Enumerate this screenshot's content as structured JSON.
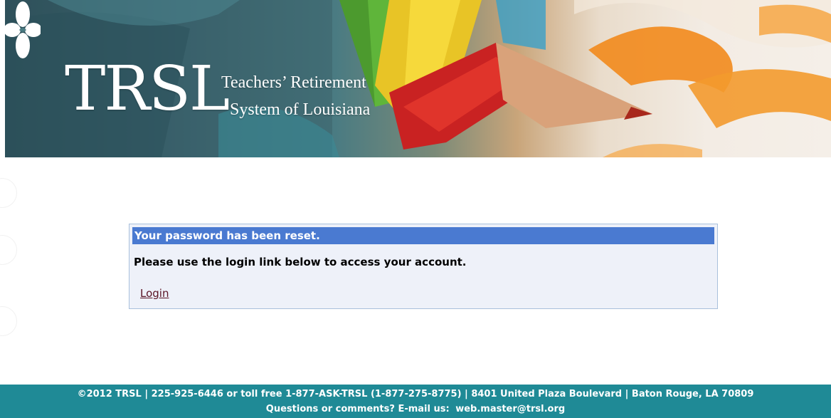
{
  "banner": {
    "logo_text": "TRSL",
    "org_name_line1": "Teachers’ Retirement",
    "org_name_line2": "System of Louisiana"
  },
  "message_panel": {
    "title": "Your password has been reset.",
    "message": "Please use the login link below to access your account.",
    "login_link": "Login"
  },
  "footer": {
    "contact_line": "©2012 TRSL | 225-925-6446 or toll free 1-877-ASK-TRSL (1-877-275-8775) | 8401 United Plaza Boulevard | Baton Rouge, LA 70809",
    "questions_label": "Questions or comments? E-mail us:",
    "email": "web.master@trsl.org"
  },
  "colors": {
    "panel_header": "#4a7ad1",
    "panel_background": "#eef1f9",
    "footer_background": "#1f8a96",
    "link": "#5a1424"
  }
}
